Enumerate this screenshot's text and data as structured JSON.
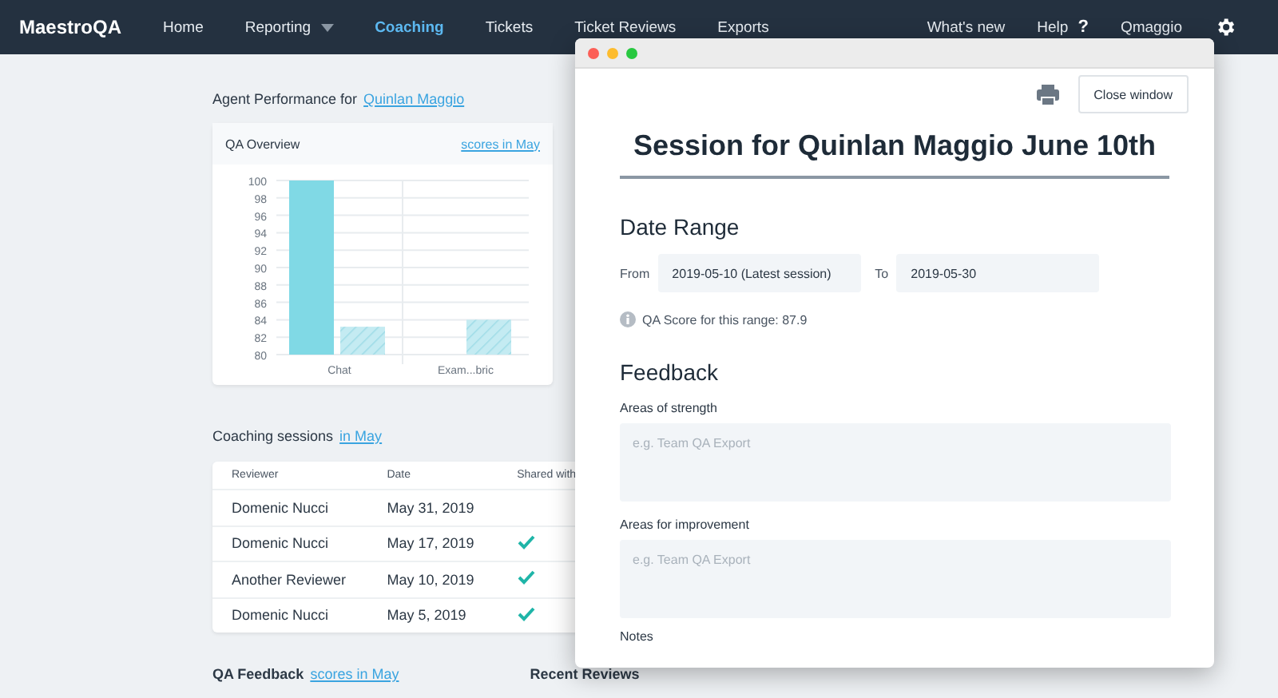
{
  "nav": {
    "logo": "MaestroQA",
    "items": [
      {
        "label": "Home",
        "selected": false,
        "dropdown": false
      },
      {
        "label": "Reporting",
        "selected": false,
        "dropdown": true
      },
      {
        "label": "Coaching",
        "selected": true,
        "dropdown": false
      },
      {
        "label": "Tickets",
        "selected": false,
        "dropdown": false
      },
      {
        "label": "Ticket Reviews",
        "selected": false,
        "dropdown": false
      },
      {
        "label": "Exports",
        "selected": false,
        "dropdown": false
      }
    ],
    "right": [
      {
        "label": "What's new"
      },
      {
        "label": "Help",
        "suffix": "?"
      },
      {
        "label": "Qmaggio"
      }
    ]
  },
  "agent_performance": {
    "label": "Agent Performance for",
    "agent": "Quinlan Maggio",
    "card": {
      "title": "QA Overview",
      "link": "scores in May",
      "chart_data": {
        "type": "bar",
        "categories": [
          "Chat",
          "Exam...bric"
        ],
        "series": [
          {
            "color": "#80d9e5",
            "values": [
              100,
              null
            ]
          },
          {
            "color": "#c4ebf2",
            "values": [
              83.2,
              84
            ]
          }
        ],
        "ylim": [
          80,
          100
        ],
        "grid": true,
        "yticks": [
          80,
          82,
          84,
          86,
          88,
          90,
          92,
          94,
          96,
          98,
          100
        ]
      }
    }
  },
  "coaching_sessions": {
    "title": "Coaching sessions",
    "link": "in May",
    "columns": [
      "Reviewer",
      "Date",
      "Shared with"
    ],
    "rows": [
      {
        "reviewer": "Domenic Nucci",
        "date": "May 31, 2019",
        "shared": false
      },
      {
        "reviewer": "Domenic Nucci",
        "date": "May 17, 2019",
        "shared": true
      },
      {
        "reviewer": "Another Reviewer",
        "date": "May 10, 2019",
        "shared": true
      },
      {
        "reviewer": "Domenic Nucci",
        "date": "May 5, 2019",
        "shared": true
      }
    ]
  },
  "bottom": {
    "qa_feedback": "QA Feedback",
    "qa_link": "scores in May",
    "recent_reviews": "Recent Reviews"
  },
  "modal": {
    "close_button": "Close window",
    "title": "Session for Quinlan Maggio June 10th",
    "date_range": {
      "heading": "Date Range",
      "from_label": "From",
      "from_value": "2019-05-10 (Latest session)",
      "to_label": "To",
      "to_value": "2019-05-30",
      "score": "QA Score for this range: 87.9"
    },
    "feedback": {
      "heading": "Feedback",
      "fields": [
        {
          "label": "Areas of strength",
          "placeholder": "e.g. Team QA Export"
        },
        {
          "label": "Areas for improvement",
          "placeholder": "e.g. Team QA Export"
        }
      ],
      "next_label": "Notes"
    }
  }
}
